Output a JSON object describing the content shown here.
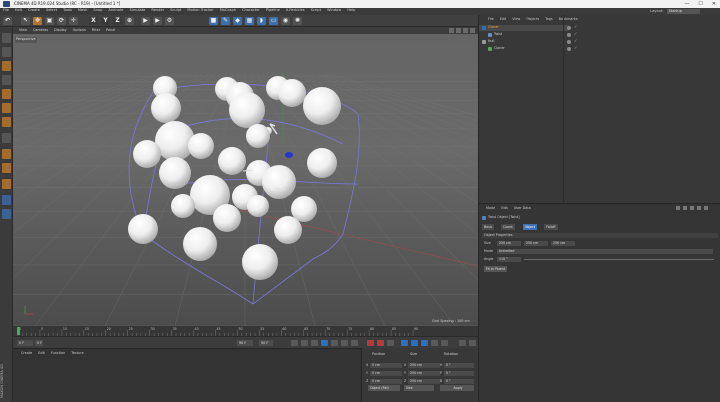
{
  "window": {
    "title": "CINEMA 4D R19.024 Studio (RC - R19) - [Untitled 1 *]",
    "controls": [
      "—",
      "☐",
      "✕"
    ]
  },
  "menubar": {
    "items": [
      "File",
      "Edit",
      "Create",
      "Select",
      "Tools",
      "Mesh",
      "Snap",
      "Animate",
      "Simulate",
      "Render",
      "Sculpt",
      "Motion Tracker",
      "MoGraph",
      "Character",
      "Pipeline",
      "X-Particles",
      "Script",
      "Window",
      "Help"
    ],
    "layout_label": "Layout:",
    "layout_value": "Startup"
  },
  "toolbar": {
    "x_label": "X",
    "y_label": "Y",
    "z_label": "Z"
  },
  "viewport": {
    "menu": [
      "View",
      "Cameras",
      "Display",
      "Options",
      "Filter",
      "Panel"
    ],
    "camera_label": "Perspective",
    "grid_spacing": "Grid Spacing : 100 cm",
    "background_color": "#5a5a5a"
  },
  "timeline": {
    "ticks": [
      "0",
      "5",
      "10",
      "15",
      "20",
      "25",
      "30",
      "35",
      "40",
      "45",
      "50",
      "55",
      "60",
      "65",
      "70",
      "75",
      "80",
      "85",
      "90"
    ],
    "current_frame_field": "0 F",
    "start_field": "0 F",
    "end_field": "90 F",
    "end_field2": "90 F"
  },
  "material_panel": {
    "menu": [
      "Create",
      "Edit",
      "Function",
      "Texture"
    ],
    "side_brand": "MAXON CINEMA 4D"
  },
  "coordinates": {
    "headers": [
      "Position",
      "Size",
      "Rotation"
    ],
    "position": [
      "0 cm",
      "0 cm",
      "0 cm"
    ],
    "size": [
      "250 cm",
      "250 cm",
      "250 cm"
    ],
    "rotation": [
      "0 °",
      "0 °",
      "0 °"
    ],
    "axis_labels_left": [
      "X",
      "Y",
      "Z"
    ],
    "axis_labels_size": [
      "X",
      "Y",
      "Z"
    ],
    "axis_labels_rot": [
      "H",
      "P",
      "B"
    ],
    "mode_dropdown": "Object (Rel)",
    "size_dropdown": "Size",
    "apply_button": "Apply"
  },
  "object_manager": {
    "menu": [
      "File",
      "Edit",
      "View",
      "Objects",
      "Tags",
      "Bookmarks"
    ],
    "objects": [
      {
        "name": "Cloner",
        "color": "#2f6fbf",
        "selected": true
      },
      {
        "name": "Twist",
        "color": "#6a8fbf",
        "selected": false
      },
      {
        "name": "Null",
        "color": "#9a9a9a",
        "selected": false
      },
      {
        "name": "Cloner",
        "color": "#5ba35b",
        "selected": false
      }
    ]
  },
  "attribute_manager": {
    "menu": [
      "Mode",
      "Edit",
      "User Data"
    ],
    "object_title": "Twist Object [Twist]",
    "tabs": [
      "Basic",
      "Coord.",
      "Object",
      "Falloff"
    ],
    "active_tab": "Object",
    "section": "Object Properties",
    "size_label": "Size",
    "size_values": [
      "250 cm",
      "250 cm",
      "250 cm"
    ],
    "mode_label": "Mode",
    "mode_value": "Unlimited",
    "angle_label": "Angle",
    "angle_value": "110 °",
    "fit_button": "Fit to Parent"
  },
  "colors": {
    "accent": "#3d70b5",
    "sphere": "#e8e8e8",
    "deformer_cage": "#7a78d8"
  }
}
